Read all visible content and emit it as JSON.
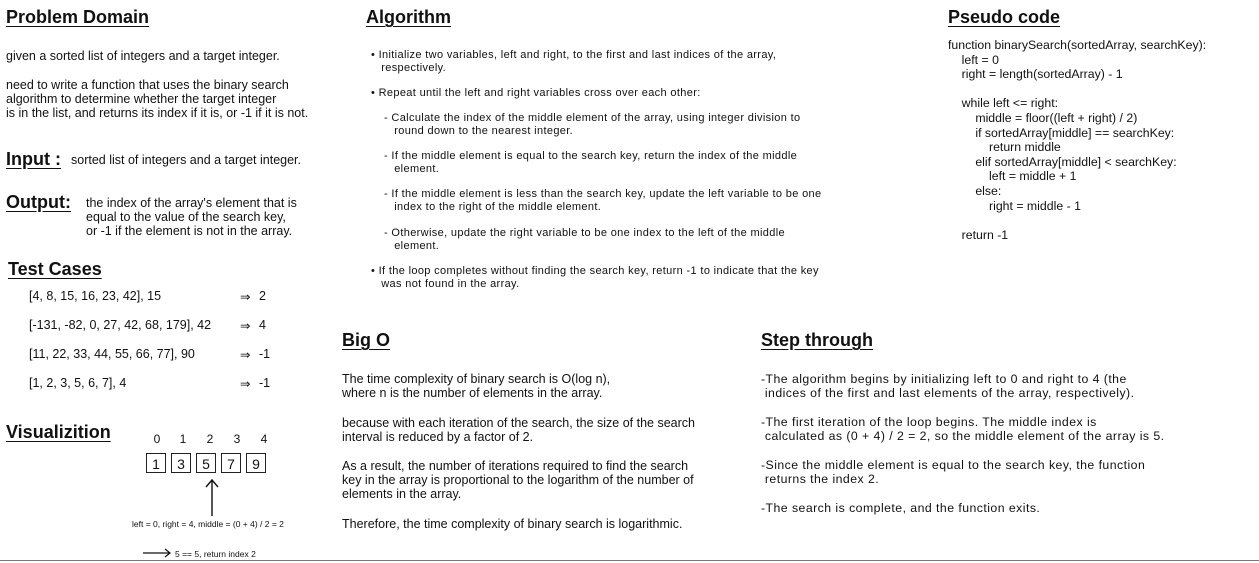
{
  "problem_domain": {
    "heading": "Problem Domain",
    "line1": "given a sorted list of integers and a target integer.",
    "line2": "need to write a function that uses the binary search\nalgorithm to determine whether the target integer\nis in the list, and returns its index if it is, or -1 if it is not."
  },
  "input": {
    "heading": "Input :",
    "text": "sorted list of integers and a target integer."
  },
  "output": {
    "heading": "Output:",
    "text": "the index of the array's element that is\nequal to the value of the search key,\nor -1 if the element is not in the array."
  },
  "test_cases": {
    "heading": "Test Cases",
    "items": [
      {
        "input": "[4, 8, 15, 16, 23, 42],  15",
        "arrow": "⇒",
        "result": "2"
      },
      {
        "input": "[-131, -82, 0, 27, 42, 68, 179],  42",
        "arrow": "⇒",
        "result": "4"
      },
      {
        "input": "[11, 22, 33, 44, 55, 66, 77],  90",
        "arrow": "⇒",
        "result": "-1"
      },
      {
        "input": "[1, 2, 3, 5, 6, 7],  4",
        "arrow": "⇒",
        "result": "-1"
      }
    ]
  },
  "visualization": {
    "heading": "Visualizition",
    "indices": [
      "0",
      "1",
      "2",
      "3",
      "4"
    ],
    "values": [
      "1",
      "3",
      "5",
      "7",
      "9"
    ],
    "caption": "left = 0, right = 4, middle = (0 + 4) / 2 = 2",
    "result_note": "5 == 5, return index 2"
  },
  "algorithm": {
    "heading": "Algorithm",
    "b1": "• Initialize two variables, left and right, to the first and last indices of the array,\n   respectively.",
    "b2": "• Repeat until the left and right variables cross over each other:",
    "s1": "- Calculate the index of the middle element of the array, using integer division to\n   round down to the nearest integer.",
    "s2": "- If the middle element is equal to the search key, return the index of the middle\n   element.",
    "s3": "- If the middle element is less than the search key, update the left variable to be one\n   index to the right of the middle element.",
    "s4": "- Otherwise, update the right variable to be one index to the left of the middle\n   element.",
    "b3": "• If the loop completes without finding the search key, return -1 to indicate that the key\n   was not found in the array."
  },
  "pseudo": {
    "heading": "Pseudo code",
    "code": "function binarySearch(sortedArray, searchKey):\n    left = 0\n    right = length(sortedArray) - 1\n\n    while left <= right:\n        middle = floor((left + right) / 2)\n        if sortedArray[middle] == searchKey:\n            return middle\n        elif sortedArray[middle] < searchKey:\n            left = middle + 1\n        else:\n            right = middle - 1\n\n    return -1"
  },
  "big_o": {
    "heading": "Big O",
    "p1": "The time complexity of binary search is O(log n),\nwhere n is the number of elements in the array.",
    "p2": "because with each iteration of the search, the size of the search\ninterval is reduced by a factor of 2.",
    "p3": "As a result, the number of iterations required to find the search\nkey in the array is proportional to the logarithm of the number of\nelements in the array.",
    "p4": "Therefore, the time complexity of binary search is logarithmic."
  },
  "step_through": {
    "heading": "Step through",
    "s1": "-The algorithm begins by initializing left to 0 and right to 4 (the\n indices of the first and last elements of the array, respectively).",
    "s2": "-The first iteration of the loop begins. The middle index is\n calculated as (0 + 4) / 2 = 2, so the middle element of the array is 5.",
    "s3": "-Since the middle element is equal to the search key, the function\n returns the index 2.",
    "s4": "-The search is complete, and the function exits."
  }
}
